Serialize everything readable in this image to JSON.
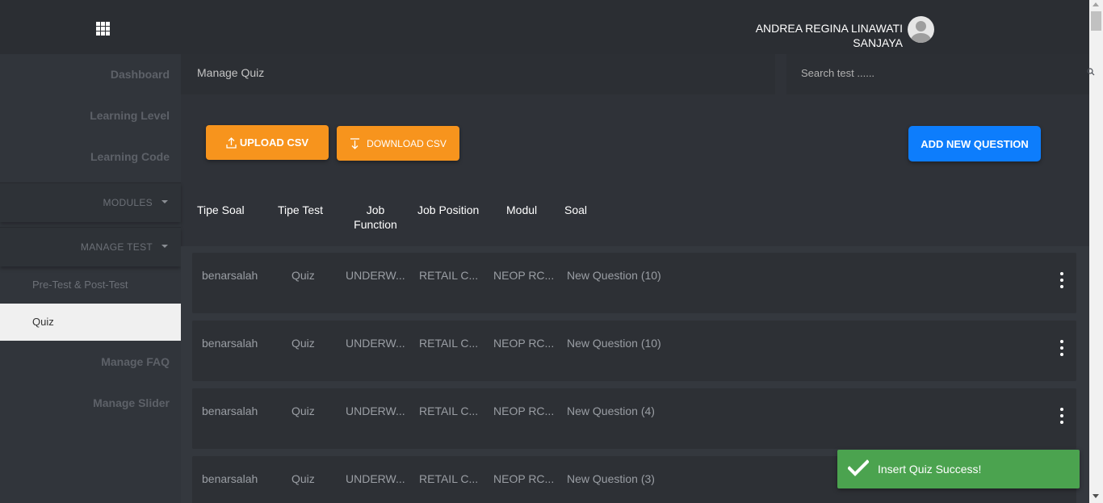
{
  "topbar": {
    "menu_icon": "apps-grid-icon",
    "user_name_line1": "ANDREA REGINA LINAWATI",
    "user_name_line2": "SANJAYA",
    "avatar_icon": "user-avatar-icon"
  },
  "sidebar": {
    "items": [
      {
        "label": "Dashboard"
      },
      {
        "label": "Learning Level"
      },
      {
        "label": "Learning Code"
      }
    ],
    "modules_label": "MODULES",
    "manage_test_label": "MANAGE TEST",
    "manage_test_children": [
      {
        "label": "Pre-Test & Post-Test",
        "active": false
      },
      {
        "label": "Quiz",
        "active": true
      }
    ],
    "bottom_items": [
      {
        "label": "Manage FAQ"
      },
      {
        "label": "Manage Slider"
      }
    ]
  },
  "breadcrumb": "Manage Quiz",
  "search": {
    "placeholder": "Search test ......",
    "icon": "search-icon"
  },
  "toolbar": {
    "upload_label": "UPLOAD CSV",
    "download_label": "DOWNLOAD CSV",
    "add_label": "ADD NEW QUESTION"
  },
  "table": {
    "headers": {
      "tipe_soal": "Tipe Soal",
      "tipe_test": "Tipe Test",
      "job_function_1": "Job",
      "job_function_2": "Function",
      "job_position": "Job Position",
      "modul": "Modul",
      "soal": "Soal"
    },
    "rows": [
      {
        "tipe_soal": "benarsalah",
        "tipe_test": "Quiz",
        "job_function": "UNDERW...",
        "job_position": "RETAIL C...",
        "modul": "NEOP RC...",
        "soal": "New Question (10)"
      },
      {
        "tipe_soal": "benarsalah",
        "tipe_test": "Quiz",
        "job_function": "UNDERW...",
        "job_position": "RETAIL C...",
        "modul": "NEOP RC...",
        "soal": "New Question (10)"
      },
      {
        "tipe_soal": "benarsalah",
        "tipe_test": "Quiz",
        "job_function": "UNDERW...",
        "job_position": "RETAIL C...",
        "modul": "NEOP RC...",
        "soal": "New Question (4)"
      },
      {
        "tipe_soal": "benarsalah",
        "tipe_test": "Quiz",
        "job_function": "UNDERW...",
        "job_position": "RETAIL C...",
        "modul": "NEOP RC...",
        "soal": "New Question (3)"
      }
    ]
  },
  "toast": {
    "message": "Insert Quiz Success!",
    "icon": "check-icon"
  },
  "colors": {
    "orange": "#f7941d",
    "blue": "#0d7dfc",
    "toast_green": "#4ba34f",
    "background": "#2f3238"
  }
}
